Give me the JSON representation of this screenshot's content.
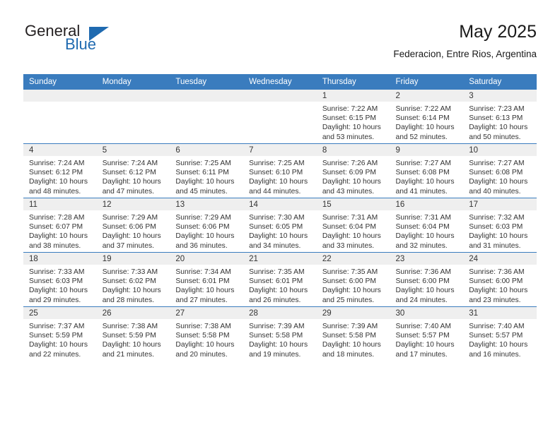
{
  "logo": {
    "word_top": "General",
    "word_bottom": "Blue",
    "triangle_color": "#1f6ab0"
  },
  "header": {
    "title": "May 2025",
    "subtitle": "Federacion, Entre Rios, Argentina"
  },
  "colors": {
    "header_band": "#3a7cbe",
    "daynum_band": "#efefef",
    "text": "#333333"
  },
  "weekday_headers": [
    "Sunday",
    "Monday",
    "Tuesday",
    "Wednesday",
    "Thursday",
    "Friday",
    "Saturday"
  ],
  "labels": {
    "sunrise_prefix": "Sunrise:",
    "sunset_prefix": "Sunset:",
    "daylight_prefix": "Daylight:"
  },
  "weeks": [
    [
      {
        "day": "",
        "empty": true
      },
      {
        "day": "",
        "empty": true
      },
      {
        "day": "",
        "empty": true
      },
      {
        "day": "",
        "empty": true
      },
      {
        "day": "1",
        "sunrise": "Sunrise: 7:22 AM",
        "sunset": "Sunset: 6:15 PM",
        "daylight": "Daylight: 10 hours and 53 minutes."
      },
      {
        "day": "2",
        "sunrise": "Sunrise: 7:22 AM",
        "sunset": "Sunset: 6:14 PM",
        "daylight": "Daylight: 10 hours and 52 minutes."
      },
      {
        "day": "3",
        "sunrise": "Sunrise: 7:23 AM",
        "sunset": "Sunset: 6:13 PM",
        "daylight": "Daylight: 10 hours and 50 minutes."
      }
    ],
    [
      {
        "day": "4",
        "sunrise": "Sunrise: 7:24 AM",
        "sunset": "Sunset: 6:12 PM",
        "daylight": "Daylight: 10 hours and 48 minutes."
      },
      {
        "day": "5",
        "sunrise": "Sunrise: 7:24 AM",
        "sunset": "Sunset: 6:12 PM",
        "daylight": "Daylight: 10 hours and 47 minutes."
      },
      {
        "day": "6",
        "sunrise": "Sunrise: 7:25 AM",
        "sunset": "Sunset: 6:11 PM",
        "daylight": "Daylight: 10 hours and 45 minutes."
      },
      {
        "day": "7",
        "sunrise": "Sunrise: 7:25 AM",
        "sunset": "Sunset: 6:10 PM",
        "daylight": "Daylight: 10 hours and 44 minutes."
      },
      {
        "day": "8",
        "sunrise": "Sunrise: 7:26 AM",
        "sunset": "Sunset: 6:09 PM",
        "daylight": "Daylight: 10 hours and 43 minutes."
      },
      {
        "day": "9",
        "sunrise": "Sunrise: 7:27 AM",
        "sunset": "Sunset: 6:08 PM",
        "daylight": "Daylight: 10 hours and 41 minutes."
      },
      {
        "day": "10",
        "sunrise": "Sunrise: 7:27 AM",
        "sunset": "Sunset: 6:08 PM",
        "daylight": "Daylight: 10 hours and 40 minutes."
      }
    ],
    [
      {
        "day": "11",
        "sunrise": "Sunrise: 7:28 AM",
        "sunset": "Sunset: 6:07 PM",
        "daylight": "Daylight: 10 hours and 38 minutes."
      },
      {
        "day": "12",
        "sunrise": "Sunrise: 7:29 AM",
        "sunset": "Sunset: 6:06 PM",
        "daylight": "Daylight: 10 hours and 37 minutes."
      },
      {
        "day": "13",
        "sunrise": "Sunrise: 7:29 AM",
        "sunset": "Sunset: 6:06 PM",
        "daylight": "Daylight: 10 hours and 36 minutes."
      },
      {
        "day": "14",
        "sunrise": "Sunrise: 7:30 AM",
        "sunset": "Sunset: 6:05 PM",
        "daylight": "Daylight: 10 hours and 34 minutes."
      },
      {
        "day": "15",
        "sunrise": "Sunrise: 7:31 AM",
        "sunset": "Sunset: 6:04 PM",
        "daylight": "Daylight: 10 hours and 33 minutes."
      },
      {
        "day": "16",
        "sunrise": "Sunrise: 7:31 AM",
        "sunset": "Sunset: 6:04 PM",
        "daylight": "Daylight: 10 hours and 32 minutes."
      },
      {
        "day": "17",
        "sunrise": "Sunrise: 7:32 AM",
        "sunset": "Sunset: 6:03 PM",
        "daylight": "Daylight: 10 hours and 31 minutes."
      }
    ],
    [
      {
        "day": "18",
        "sunrise": "Sunrise: 7:33 AM",
        "sunset": "Sunset: 6:03 PM",
        "daylight": "Daylight: 10 hours and 29 minutes."
      },
      {
        "day": "19",
        "sunrise": "Sunrise: 7:33 AM",
        "sunset": "Sunset: 6:02 PM",
        "daylight": "Daylight: 10 hours and 28 minutes."
      },
      {
        "day": "20",
        "sunrise": "Sunrise: 7:34 AM",
        "sunset": "Sunset: 6:01 PM",
        "daylight": "Daylight: 10 hours and 27 minutes."
      },
      {
        "day": "21",
        "sunrise": "Sunrise: 7:35 AM",
        "sunset": "Sunset: 6:01 PM",
        "daylight": "Daylight: 10 hours and 26 minutes."
      },
      {
        "day": "22",
        "sunrise": "Sunrise: 7:35 AM",
        "sunset": "Sunset: 6:00 PM",
        "daylight": "Daylight: 10 hours and 25 minutes."
      },
      {
        "day": "23",
        "sunrise": "Sunrise: 7:36 AM",
        "sunset": "Sunset: 6:00 PM",
        "daylight": "Daylight: 10 hours and 24 minutes."
      },
      {
        "day": "24",
        "sunrise": "Sunrise: 7:36 AM",
        "sunset": "Sunset: 6:00 PM",
        "daylight": "Daylight: 10 hours and 23 minutes."
      }
    ],
    [
      {
        "day": "25",
        "sunrise": "Sunrise: 7:37 AM",
        "sunset": "Sunset: 5:59 PM",
        "daylight": "Daylight: 10 hours and 22 minutes."
      },
      {
        "day": "26",
        "sunrise": "Sunrise: 7:38 AM",
        "sunset": "Sunset: 5:59 PM",
        "daylight": "Daylight: 10 hours and 21 minutes."
      },
      {
        "day": "27",
        "sunrise": "Sunrise: 7:38 AM",
        "sunset": "Sunset: 5:58 PM",
        "daylight": "Daylight: 10 hours and 20 minutes."
      },
      {
        "day": "28",
        "sunrise": "Sunrise: 7:39 AM",
        "sunset": "Sunset: 5:58 PM",
        "daylight": "Daylight: 10 hours and 19 minutes."
      },
      {
        "day": "29",
        "sunrise": "Sunrise: 7:39 AM",
        "sunset": "Sunset: 5:58 PM",
        "daylight": "Daylight: 10 hours and 18 minutes."
      },
      {
        "day": "30",
        "sunrise": "Sunrise: 7:40 AM",
        "sunset": "Sunset: 5:57 PM",
        "daylight": "Daylight: 10 hours and 17 minutes."
      },
      {
        "day": "31",
        "sunrise": "Sunrise: 7:40 AM",
        "sunset": "Sunset: 5:57 PM",
        "daylight": "Daylight: 10 hours and 16 minutes."
      }
    ]
  ]
}
